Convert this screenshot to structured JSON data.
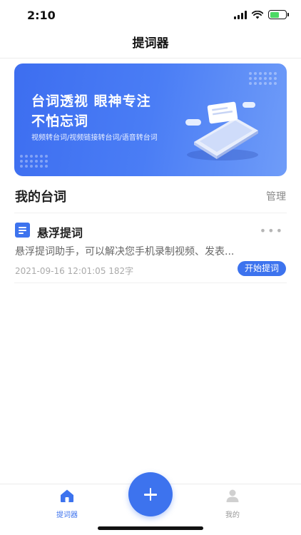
{
  "status_bar": {
    "time": "2:10"
  },
  "nav": {
    "title": "提词器"
  },
  "banner": {
    "headline_1": "台词透视 眼神专注",
    "headline_2": "不怕忘词",
    "subtitle": "视频转台词/视频链接转台词/语音转台词"
  },
  "section": {
    "title": "我的台词",
    "manage_label": "管理"
  },
  "scripts": [
    {
      "title": "悬浮提词",
      "preview": "悬浮提词助手，可以解决您手机录制视频、发表...",
      "date": "2021-09-16 12:01:05",
      "word_count": "182字",
      "action_label": "开始提词",
      "more": "•••"
    }
  ],
  "tab_bar": {
    "items": [
      {
        "label": "提词器",
        "icon": "home-icon",
        "active": true
      },
      {
        "label": "我的",
        "icon": "user-icon",
        "active": false
      }
    ],
    "add_icon": "plus-icon"
  },
  "colors": {
    "accent": "#3d73ee",
    "banner_start": "#3d6ef0",
    "banner_end": "#6f9cf8"
  }
}
